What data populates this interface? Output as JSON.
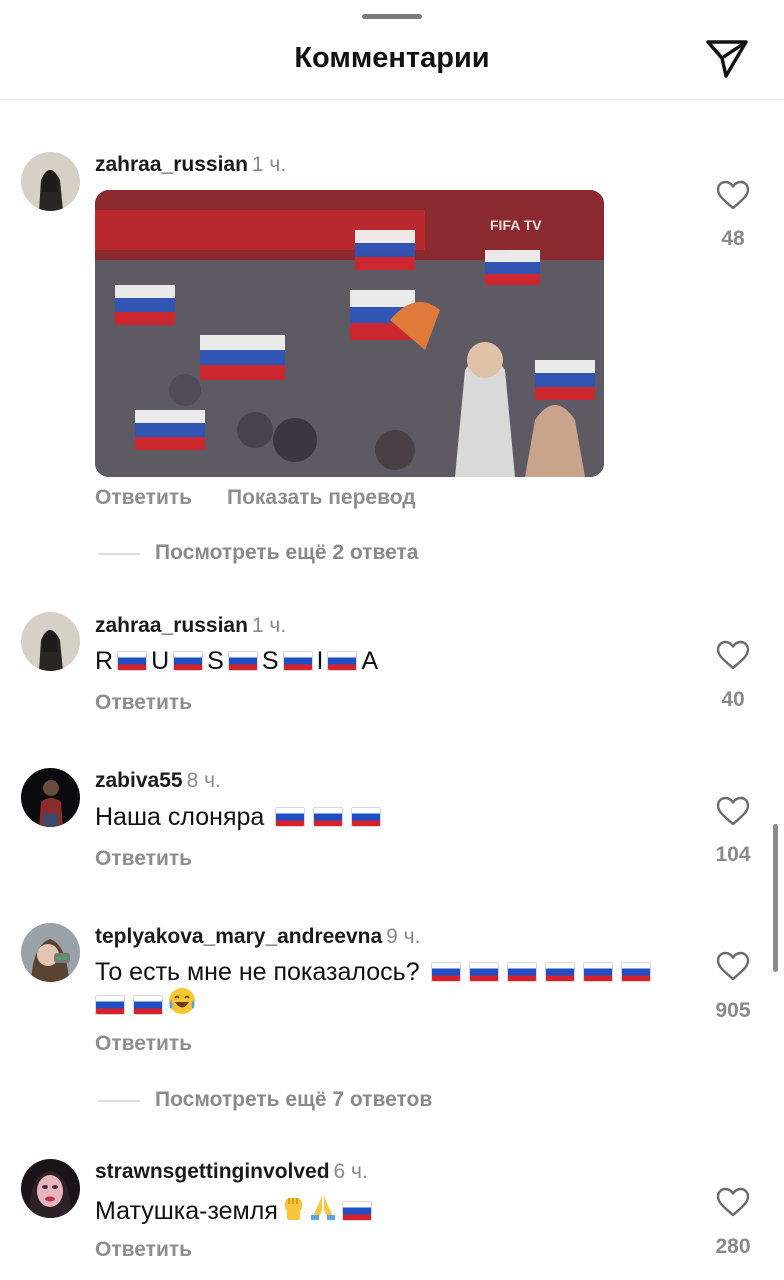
{
  "header": {
    "title": "Комментарии",
    "send_icon": "paper-plane-icon"
  },
  "comments": [
    {
      "username": "zahraa_russian",
      "time": "1 ч.",
      "has_gif": true,
      "reply": "Ответить",
      "translate": "Показать перевод",
      "likes": "48",
      "view_more": "Посмотреть ещё 2 ответа"
    },
    {
      "username": "zahraa_russian",
      "time": "1 ч.",
      "text_parts": [
        "R",
        "U",
        "S",
        "S",
        "I",
        "A"
      ],
      "reply": "Ответить",
      "likes": "40"
    },
    {
      "username": "zabiva55",
      "time": "8 ч.",
      "text": "Наша слоняра",
      "reply": "Ответить",
      "likes": "104"
    },
    {
      "username": "teplyakova_mary_andreevna",
      "time": "9 ч.",
      "text": "То есть мне не показалось?",
      "reply": "Ответить",
      "likes": "905",
      "view_more": "Посмотреть ещё 7 ответов"
    },
    {
      "username": "strawnsgettinginvolved",
      "time": "6 ч.",
      "text": "Матушка-земля",
      "reply": "Ответить",
      "likes": "280"
    }
  ],
  "colors": {
    "flag_white": "#ffffff",
    "flag_blue": "#1e4fc4",
    "flag_red": "#d8202a",
    "muted": "#8e8e8e"
  }
}
